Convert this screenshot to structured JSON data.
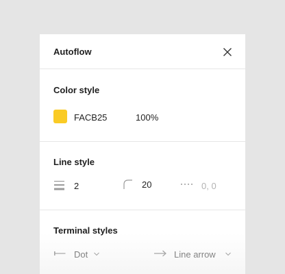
{
  "panel": {
    "title": "Autoflow",
    "close_icon": "close-icon"
  },
  "color_style": {
    "title": "Color style",
    "swatch_color": "#FACB25",
    "hex": "FACB25",
    "opacity": "100%"
  },
  "line_style": {
    "title": "Line style",
    "stroke_width_icon": "stroke-weight-icon",
    "stroke_width": "2",
    "corner_radius_icon": "corner-radius-icon",
    "corner_radius": "20",
    "dash_icon": "dash-pattern-icon",
    "dash_pattern": "0, 0"
  },
  "terminal_styles": {
    "title": "Terminal styles",
    "start": {
      "icon": "line-start-dot-icon",
      "label": "Dot"
    },
    "end": {
      "icon": "line-arrow-icon",
      "label": "Line arrow"
    }
  },
  "colors": {
    "background": "#e5e5e5",
    "panel": "#ffffff",
    "divider": "#e6e6e6",
    "muted_text": "#b3b3b3"
  }
}
